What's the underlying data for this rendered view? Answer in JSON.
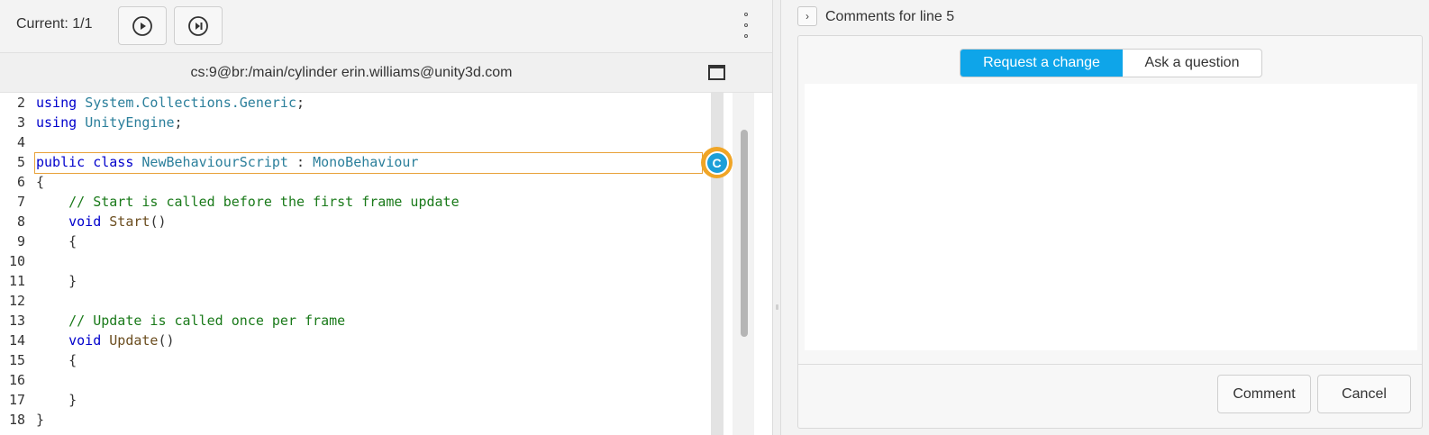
{
  "toolbar": {
    "current_label": "Current: 1/1",
    "play_icon": "play-circle-icon",
    "next_icon": "skip-next-icon",
    "more_icon": "more-vertical-icon"
  },
  "pathbar": {
    "text": "cs:9@br:/main/cylinder erin.williams@unity3d.com",
    "maximize_icon": "maximize-window-icon"
  },
  "editor": {
    "lines": [
      {
        "num": "2",
        "parts": [
          [
            "kw",
            "using"
          ],
          [
            "",
            " "
          ],
          [
            "ty",
            "System.Collections.Generic"
          ],
          [
            "",
            ";"
          ]
        ]
      },
      {
        "num": "3",
        "parts": [
          [
            "kw",
            "using"
          ],
          [
            "",
            " "
          ],
          [
            "ty",
            "UnityEngine"
          ],
          [
            "",
            ";"
          ]
        ]
      },
      {
        "num": "4",
        "parts": []
      },
      {
        "num": "5",
        "parts": [
          [
            "kw",
            "public"
          ],
          [
            "",
            " "
          ],
          [
            "kw",
            "class"
          ],
          [
            "",
            " "
          ],
          [
            "ty",
            "NewBehaviourScript"
          ],
          [
            "",
            " : "
          ],
          [
            "ty",
            "MonoBehaviour"
          ]
        ]
      },
      {
        "num": "6",
        "parts": [
          [
            "",
            "{"
          ]
        ]
      },
      {
        "num": "7",
        "parts": [
          [
            "",
            "    "
          ],
          [
            "cm",
            "// Start is called before the first frame update"
          ]
        ]
      },
      {
        "num": "8",
        "parts": [
          [
            "",
            "    "
          ],
          [
            "kw",
            "void"
          ],
          [
            "",
            " "
          ],
          [
            "fn",
            "Start"
          ],
          [
            "",
            "()"
          ]
        ]
      },
      {
        "num": "9",
        "parts": [
          [
            "",
            "    {"
          ]
        ]
      },
      {
        "num": "10",
        "parts": []
      },
      {
        "num": "11",
        "parts": [
          [
            "",
            "    }"
          ]
        ]
      },
      {
        "num": "12",
        "parts": []
      },
      {
        "num": "13",
        "parts": [
          [
            "",
            "    "
          ],
          [
            "cm",
            "// Update is called once per frame"
          ]
        ]
      },
      {
        "num": "14",
        "parts": [
          [
            "",
            "    "
          ],
          [
            "kw",
            "void"
          ],
          [
            "",
            " "
          ],
          [
            "fn",
            "Update"
          ],
          [
            "",
            "()"
          ]
        ]
      },
      {
        "num": "15",
        "parts": [
          [
            "",
            "    {"
          ]
        ]
      },
      {
        "num": "16",
        "parts": []
      },
      {
        "num": "17",
        "parts": [
          [
            "",
            "    }"
          ]
        ]
      },
      {
        "num": "18",
        "parts": [
          [
            "",
            "}"
          ]
        ]
      }
    ],
    "marker_letter": "C",
    "colors": {
      "keyword": "#0000cc",
      "type": "#2b7f9b",
      "comment": "#1a7a1a",
      "highlight_border": "#e8a23a",
      "marker_ring": "#f0a526",
      "marker_fill": "#1d9fd8"
    }
  },
  "comments": {
    "title": "Comments for line 5",
    "collapse_icon": "chevron-right-icon",
    "tabs": [
      {
        "label": "Request a change",
        "active": true
      },
      {
        "label": "Ask a question",
        "active": false
      }
    ],
    "active_color": "#0ea5e9",
    "comment_button": "Comment",
    "cancel_button": "Cancel"
  }
}
